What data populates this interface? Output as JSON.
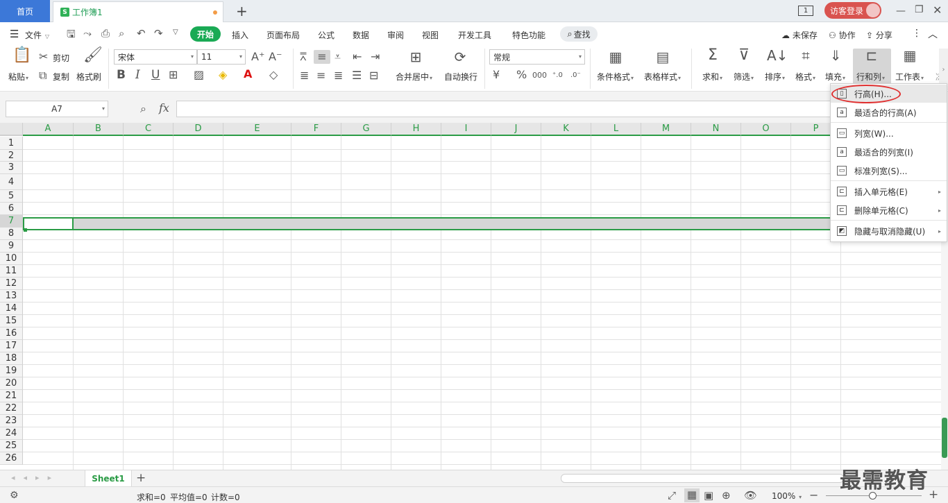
{
  "tabs": {
    "home": "首页",
    "doc": "工作簿1",
    "new_tab": "+"
  },
  "window": {
    "page_num": "1",
    "login": "访客登录"
  },
  "menu": {
    "file": "文件",
    "items": [
      "开始",
      "插入",
      "页面布局",
      "公式",
      "数据",
      "审阅",
      "视图",
      "开发工具",
      "特色功能"
    ],
    "search": "查找",
    "unsaved": "未保存",
    "collab": "协作",
    "share": "分享"
  },
  "ribbon": {
    "paste": "粘贴",
    "cut": "剪切",
    "copy": "复制",
    "format_painter": "格式刷",
    "font_name": "宋体",
    "font_size": "11",
    "number_format": "常规",
    "merge_center": "合并居中",
    "wrap_text": "自动换行",
    "cond_format": "条件格式",
    "table_style": "表格样式",
    "sum": "求和",
    "filter": "筛选",
    "sort": "排序",
    "format": "格式",
    "fill": "填充",
    "rowcol": "行和列",
    "sheet": "工作表",
    "more": "冻"
  },
  "formula": {
    "cell_ref": "A7",
    "fx": "fx",
    "value": ""
  },
  "columns": [
    "A",
    "B",
    "C",
    "D",
    "E",
    "F",
    "G",
    "H",
    "I",
    "J",
    "K",
    "L",
    "M",
    "N",
    "O",
    "P"
  ],
  "rows": [
    "1",
    "2",
    "3",
    "4",
    "5",
    "6",
    "7",
    "8",
    "9",
    "10",
    "11",
    "12",
    "13",
    "14",
    "15",
    "16",
    "17",
    "18",
    "19",
    "20",
    "21",
    "22",
    "23",
    "24",
    "25",
    "26"
  ],
  "context_menu": [
    {
      "label": "行高(H)...",
      "icon": "row-height-icon",
      "submenu": false
    },
    {
      "label": "最适合的行高(A)",
      "icon": "auto-row-height-icon",
      "submenu": false
    },
    {
      "label": "列宽(W)...",
      "icon": "col-width-icon",
      "submenu": false
    },
    {
      "label": "最适合的列宽(I)",
      "icon": "auto-col-width-icon",
      "submenu": false
    },
    {
      "label": "标准列宽(S)...",
      "icon": "std-col-width-icon",
      "submenu": false
    },
    {
      "label": "插入单元格(E)",
      "icon": "insert-cells-icon",
      "submenu": true
    },
    {
      "label": "删除单元格(C)",
      "icon": "delete-cells-icon",
      "submenu": true
    },
    {
      "label": "隐藏与取消隐藏(U)",
      "icon": "hide-unhide-icon",
      "submenu": true
    }
  ],
  "sheet_tab": "Sheet1",
  "status": {
    "sum": "求和=0",
    "avg": "平均值=0",
    "count": "计数=0",
    "zoom": "100%"
  },
  "watermark": "最需教育",
  "colors": {
    "accent": "#1aaa55",
    "home_tab": "#3c78d8",
    "header_green": "#2a9b45",
    "highlight_red": "#e03030"
  }
}
